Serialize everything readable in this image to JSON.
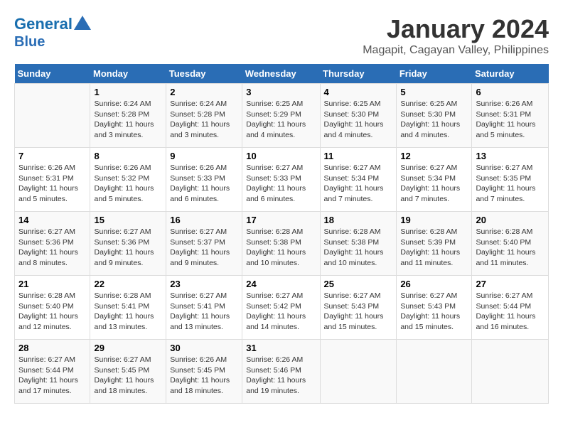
{
  "logo": {
    "line1": "General",
    "line2": "Blue"
  },
  "title": "January 2024",
  "subtitle": "Magapit, Cagayan Valley, Philippines",
  "days_of_week": [
    "Sunday",
    "Monday",
    "Tuesday",
    "Wednesday",
    "Thursday",
    "Friday",
    "Saturday"
  ],
  "weeks": [
    [
      {
        "num": "",
        "sunrise": "",
        "sunset": "",
        "daylight": ""
      },
      {
        "num": "1",
        "sunrise": "Sunrise: 6:24 AM",
        "sunset": "Sunset: 5:28 PM",
        "daylight": "Daylight: 11 hours and 3 minutes."
      },
      {
        "num": "2",
        "sunrise": "Sunrise: 6:24 AM",
        "sunset": "Sunset: 5:28 PM",
        "daylight": "Daylight: 11 hours and 3 minutes."
      },
      {
        "num": "3",
        "sunrise": "Sunrise: 6:25 AM",
        "sunset": "Sunset: 5:29 PM",
        "daylight": "Daylight: 11 hours and 4 minutes."
      },
      {
        "num": "4",
        "sunrise": "Sunrise: 6:25 AM",
        "sunset": "Sunset: 5:30 PM",
        "daylight": "Daylight: 11 hours and 4 minutes."
      },
      {
        "num": "5",
        "sunrise": "Sunrise: 6:25 AM",
        "sunset": "Sunset: 5:30 PM",
        "daylight": "Daylight: 11 hours and 4 minutes."
      },
      {
        "num": "6",
        "sunrise": "Sunrise: 6:26 AM",
        "sunset": "Sunset: 5:31 PM",
        "daylight": "Daylight: 11 hours and 5 minutes."
      }
    ],
    [
      {
        "num": "7",
        "sunrise": "Sunrise: 6:26 AM",
        "sunset": "Sunset: 5:31 PM",
        "daylight": "Daylight: 11 hours and 5 minutes."
      },
      {
        "num": "8",
        "sunrise": "Sunrise: 6:26 AM",
        "sunset": "Sunset: 5:32 PM",
        "daylight": "Daylight: 11 hours and 5 minutes."
      },
      {
        "num": "9",
        "sunrise": "Sunrise: 6:26 AM",
        "sunset": "Sunset: 5:33 PM",
        "daylight": "Daylight: 11 hours and 6 minutes."
      },
      {
        "num": "10",
        "sunrise": "Sunrise: 6:27 AM",
        "sunset": "Sunset: 5:33 PM",
        "daylight": "Daylight: 11 hours and 6 minutes."
      },
      {
        "num": "11",
        "sunrise": "Sunrise: 6:27 AM",
        "sunset": "Sunset: 5:34 PM",
        "daylight": "Daylight: 11 hours and 7 minutes."
      },
      {
        "num": "12",
        "sunrise": "Sunrise: 6:27 AM",
        "sunset": "Sunset: 5:34 PM",
        "daylight": "Daylight: 11 hours and 7 minutes."
      },
      {
        "num": "13",
        "sunrise": "Sunrise: 6:27 AM",
        "sunset": "Sunset: 5:35 PM",
        "daylight": "Daylight: 11 hours and 7 minutes."
      }
    ],
    [
      {
        "num": "14",
        "sunrise": "Sunrise: 6:27 AM",
        "sunset": "Sunset: 5:36 PM",
        "daylight": "Daylight: 11 hours and 8 minutes."
      },
      {
        "num": "15",
        "sunrise": "Sunrise: 6:27 AM",
        "sunset": "Sunset: 5:36 PM",
        "daylight": "Daylight: 11 hours and 9 minutes."
      },
      {
        "num": "16",
        "sunrise": "Sunrise: 6:27 AM",
        "sunset": "Sunset: 5:37 PM",
        "daylight": "Daylight: 11 hours and 9 minutes."
      },
      {
        "num": "17",
        "sunrise": "Sunrise: 6:28 AM",
        "sunset": "Sunset: 5:38 PM",
        "daylight": "Daylight: 11 hours and 10 minutes."
      },
      {
        "num": "18",
        "sunrise": "Sunrise: 6:28 AM",
        "sunset": "Sunset: 5:38 PM",
        "daylight": "Daylight: 11 hours and 10 minutes."
      },
      {
        "num": "19",
        "sunrise": "Sunrise: 6:28 AM",
        "sunset": "Sunset: 5:39 PM",
        "daylight": "Daylight: 11 hours and 11 minutes."
      },
      {
        "num": "20",
        "sunrise": "Sunrise: 6:28 AM",
        "sunset": "Sunset: 5:40 PM",
        "daylight": "Daylight: 11 hours and 11 minutes."
      }
    ],
    [
      {
        "num": "21",
        "sunrise": "Sunrise: 6:28 AM",
        "sunset": "Sunset: 5:40 PM",
        "daylight": "Daylight: 11 hours and 12 minutes."
      },
      {
        "num": "22",
        "sunrise": "Sunrise: 6:28 AM",
        "sunset": "Sunset: 5:41 PM",
        "daylight": "Daylight: 11 hours and 13 minutes."
      },
      {
        "num": "23",
        "sunrise": "Sunrise: 6:27 AM",
        "sunset": "Sunset: 5:41 PM",
        "daylight": "Daylight: 11 hours and 13 minutes."
      },
      {
        "num": "24",
        "sunrise": "Sunrise: 6:27 AM",
        "sunset": "Sunset: 5:42 PM",
        "daylight": "Daylight: 11 hours and 14 minutes."
      },
      {
        "num": "25",
        "sunrise": "Sunrise: 6:27 AM",
        "sunset": "Sunset: 5:43 PM",
        "daylight": "Daylight: 11 hours and 15 minutes."
      },
      {
        "num": "26",
        "sunrise": "Sunrise: 6:27 AM",
        "sunset": "Sunset: 5:43 PM",
        "daylight": "Daylight: 11 hours and 15 minutes."
      },
      {
        "num": "27",
        "sunrise": "Sunrise: 6:27 AM",
        "sunset": "Sunset: 5:44 PM",
        "daylight": "Daylight: 11 hours and 16 minutes."
      }
    ],
    [
      {
        "num": "28",
        "sunrise": "Sunrise: 6:27 AM",
        "sunset": "Sunset: 5:44 PM",
        "daylight": "Daylight: 11 hours and 17 minutes."
      },
      {
        "num": "29",
        "sunrise": "Sunrise: 6:27 AM",
        "sunset": "Sunset: 5:45 PM",
        "daylight": "Daylight: 11 hours and 18 minutes."
      },
      {
        "num": "30",
        "sunrise": "Sunrise: 6:26 AM",
        "sunset": "Sunset: 5:45 PM",
        "daylight": "Daylight: 11 hours and 18 minutes."
      },
      {
        "num": "31",
        "sunrise": "Sunrise: 6:26 AM",
        "sunset": "Sunset: 5:46 PM",
        "daylight": "Daylight: 11 hours and 19 minutes."
      },
      {
        "num": "",
        "sunrise": "",
        "sunset": "",
        "daylight": ""
      },
      {
        "num": "",
        "sunrise": "",
        "sunset": "",
        "daylight": ""
      },
      {
        "num": "",
        "sunrise": "",
        "sunset": "",
        "daylight": ""
      }
    ]
  ]
}
